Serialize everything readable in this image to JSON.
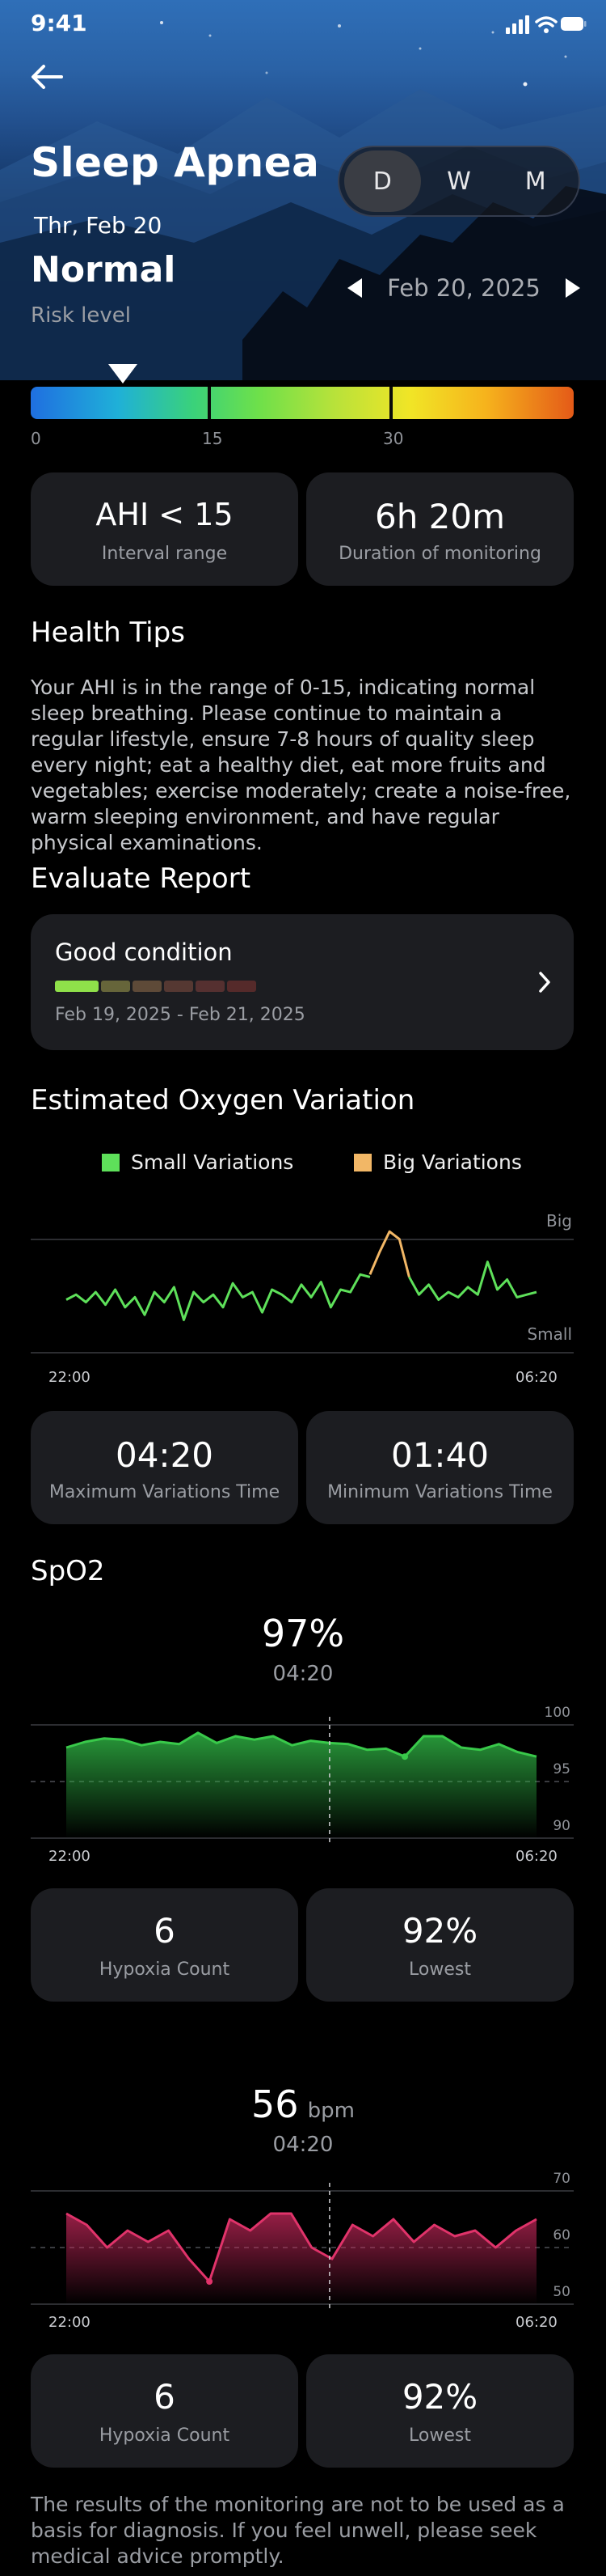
{
  "status_bar": {
    "time": "9:41"
  },
  "header": {
    "title": "Sleep Apnea",
    "date": "Thr, Feb 20",
    "period_tabs": [
      {
        "label": "D",
        "active": true
      },
      {
        "label": "W",
        "active": false
      },
      {
        "label": "M",
        "active": false
      }
    ],
    "status": "Normal",
    "status_caption": "Risk level",
    "nav_date": "Feb 20, 2025"
  },
  "risk_scale": {
    "ticks": [
      "0",
      "15",
      "30"
    ],
    "ahi_marker_value": 4
  },
  "summary": {
    "ahi_value": "AHI < 15",
    "ahi_label": "Interval range",
    "duration_value": "6h 20m",
    "duration_label": "Duration of monitoring"
  },
  "health_tips": {
    "title": "Health Tips",
    "text": "Your AHI is in the range of 0-15, indicating normal sleep breathing. Please continue to maintain a regular lifestyle, ensure 7-8 hours of quality sleep every night; eat a healthy diet, eat more fruits and vegetables; exercise moderately; create a noise-free, warm sleeping environment, and have regular physical examinations."
  },
  "report": {
    "title": "Evaluate Report",
    "condition": "Good condition",
    "range": "Feb 19, 2025 - Feb 21, 2025",
    "level_colors": [
      "#8fe04a",
      "#6a6a3a",
      "#6a4a3a",
      "#5a3630",
      "#5a3030",
      "#5a2a2a"
    ]
  },
  "oxygen_variation": {
    "title": "Estimated Oxygen Variation",
    "legend_small": "Small Variations",
    "legend_big": "Big Variations",
    "color_small": "#5ee05a",
    "color_big": "#f2b766",
    "label_big": "Big",
    "label_small": "Small",
    "x_start": "22:00",
    "x_end": "06:20",
    "max_time": "04:20",
    "max_label": "Maximum Variations Time",
    "min_time": "01:40",
    "min_label": "Minimum Variations Time"
  },
  "spo2": {
    "title": "SpO2",
    "value": "97%",
    "time": "04:20",
    "x_start": "22:00",
    "x_end": "06:20",
    "y_ticks": [
      "100",
      "95",
      "90"
    ],
    "hypoxia_count": "6",
    "hypoxia_label": "Hypoxia Count",
    "lowest": "92%",
    "lowest_label": "Lowest",
    "color": "#39c94a"
  },
  "heart_rate": {
    "value": "56",
    "unit": "bpm",
    "time": "04:20",
    "x_start": "22:00",
    "x_end": "06:20",
    "y_ticks": [
      "70",
      "60",
      "50"
    ],
    "hypoxia_count": "6",
    "hypoxia_label": "Hypoxia Count",
    "lowest": "92%",
    "lowest_label": "Lowest",
    "color": "#e0336a"
  },
  "chart_data": [
    {
      "type": "line",
      "title": "",
      "xlabel": "",
      "ylabel": "",
      "x_range": [
        "22:00",
        "06:20"
      ],
      "series": [
        {
          "name": "Small Variations",
          "values": [
            0.42,
            0.46,
            0.4,
            0.48,
            0.38,
            0.5,
            0.36,
            0.44,
            0.3,
            0.48,
            0.4,
            0.52,
            0.26,
            0.48,
            0.4,
            0.46,
            0.36,
            0.55,
            0.44,
            0.48,
            0.32,
            0.5,
            0.46,
            0.4,
            0.54,
            0.44,
            0.56,
            0.36,
            0.5,
            0.48,
            0.62,
            0.6
          ]
        },
        {
          "name": "Big Variations",
          "values": [
            0.62,
            0.8,
            0.96,
            0.9,
            0.6
          ]
        },
        {
          "name": "Small Variations",
          "values": [
            0.6,
            0.46,
            0.54,
            0.42,
            0.48,
            0.44,
            0.52,
            0.46,
            0.72,
            0.5,
            0.58,
            0.44,
            0.46,
            0.48
          ]
        }
      ]
    },
    {
      "type": "area",
      "title": "",
      "x_range": [
        "22:00",
        "06:20"
      ],
      "ylim": [
        90,
        100
      ],
      "y_ticks": [
        100,
        95,
        90
      ],
      "series": [
        {
          "name": "",
          "values": [
            98,
            98.5,
            98.8,
            98.7,
            98.2,
            98.5,
            98.3,
            99.3,
            98.4,
            99.0,
            98.7,
            99.0,
            98.2,
            98.6,
            98.4,
            98.3,
            97.8,
            97.9,
            97.2,
            99.0,
            99.0,
            98.0,
            97.8,
            98.3,
            97.6,
            97.2
          ]
        }
      ],
      "highlight_x": "04:20",
      "highlight_value": 97
    },
    {
      "type": "area",
      "title": "",
      "x_range": [
        "22:00",
        "06:20"
      ],
      "ylim": [
        50,
        70
      ],
      "y_ticks": [
        70,
        60,
        50
      ],
      "series": [
        {
          "name": "",
          "values": [
            66,
            64,
            60,
            63,
            61,
            63,
            58,
            54,
            65,
            63,
            66,
            66,
            60,
            58,
            64,
            62,
            65,
            61,
            64,
            62,
            63,
            60,
            63,
            65
          ]
        }
      ],
      "highlight_x": "04:20",
      "highlight_value": 56
    }
  ]
}
